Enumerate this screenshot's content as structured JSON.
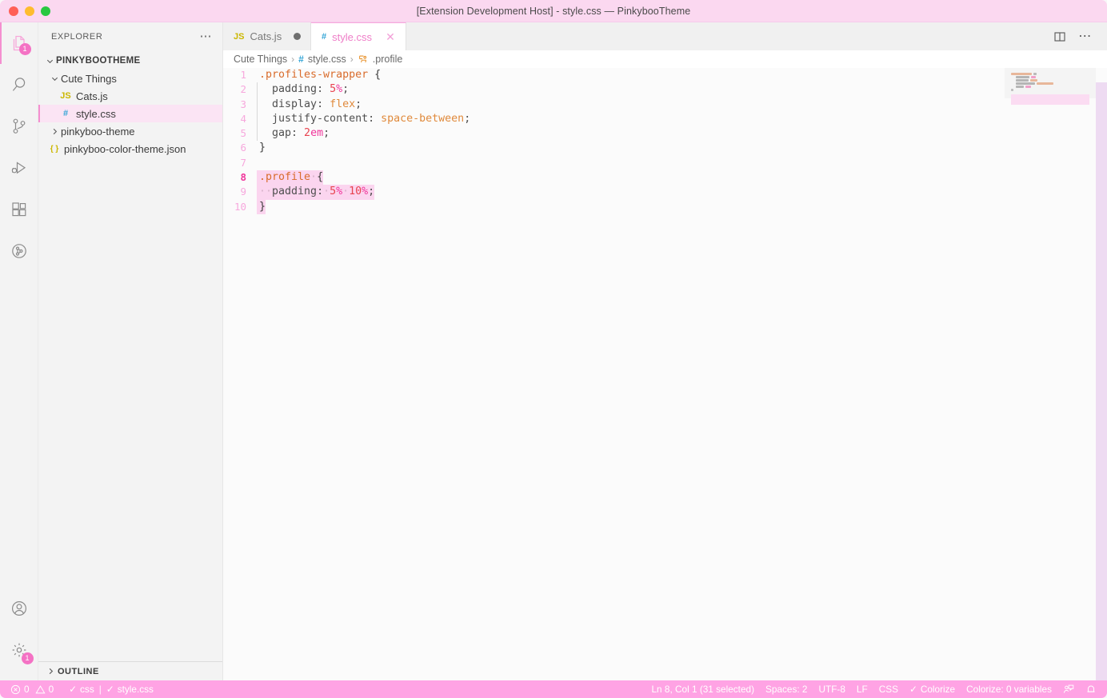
{
  "window": {
    "title": "[Extension Development Host] - style.css — PinkybooTheme",
    "traffic_lights": [
      "close",
      "minimize",
      "zoom"
    ],
    "accent": "#f48fd0",
    "titlebar_bg": "#fbd8f0",
    "statusbar_bg": "#ffa3e4"
  },
  "activity_bar": {
    "items": [
      {
        "name": "explorer",
        "icon": "files-icon",
        "active": true,
        "badge": "1"
      },
      {
        "name": "search",
        "icon": "search-icon",
        "active": false,
        "badge": ""
      },
      {
        "name": "source-control",
        "icon": "source-control-icon",
        "active": false,
        "badge": ""
      },
      {
        "name": "run-and-debug",
        "icon": "run-debug-icon",
        "active": false,
        "badge": ""
      },
      {
        "name": "extensions",
        "icon": "extensions-icon",
        "active": false,
        "badge": ""
      },
      {
        "name": "testing",
        "icon": "beaker-icon",
        "active": false,
        "badge": ""
      }
    ],
    "bottom_items": [
      {
        "name": "accounts",
        "icon": "account-icon",
        "badge": ""
      },
      {
        "name": "manage",
        "icon": "gear-icon",
        "badge": "1"
      }
    ]
  },
  "sidebar": {
    "header": {
      "title": "EXPLORER",
      "more_actions": "⋯"
    },
    "root": {
      "label": "PINKYBOOTHEME",
      "expanded": true,
      "chevron": "chevron-down-icon"
    },
    "tree": [
      {
        "label": "Cute Things",
        "level": 1,
        "type": "folder",
        "expanded": true,
        "icon": "chevron-down-icon",
        "selected": false
      },
      {
        "label": "Cats.js",
        "level": 2,
        "type": "file",
        "icon": "js-icon",
        "icon_text": "JS",
        "icon_color": "#cbb700",
        "selected": false
      },
      {
        "label": "style.css",
        "level": 2,
        "type": "file",
        "icon": "css-icon",
        "icon_text": "#",
        "icon_color": "#34a5d6",
        "selected": true
      },
      {
        "label": "pinkyboo-theme",
        "level": 1,
        "type": "folder",
        "expanded": false,
        "icon": "chevron-right-icon",
        "selected": false
      },
      {
        "label": "pinkyboo-color-theme.json",
        "level": 1,
        "type": "file",
        "icon": "json-icon",
        "icon_text": "{ }",
        "icon_color": "#cbb700",
        "selected": false
      }
    ],
    "outline": {
      "label": "OUTLINE",
      "expanded": false,
      "chevron": "chevron-right-icon"
    }
  },
  "tabs": {
    "items": [
      {
        "label": "Cats.js",
        "icon_text": "JS",
        "icon_color": "#cbb700",
        "active": false,
        "dirty": true,
        "closable": false
      },
      {
        "label": "style.css",
        "icon_text": "#",
        "icon_color": "#34a5d6",
        "active": true,
        "dirty": false,
        "closable": true,
        "close_glyph": "✕"
      }
    ],
    "actions": [
      {
        "name": "split-editor-button",
        "icon": "split-editor-icon"
      },
      {
        "name": "more-actions-button",
        "icon": "kebab-icon",
        "glyph": "⋯"
      }
    ]
  },
  "breadcrumbs": {
    "separator": "›",
    "items": [
      {
        "label": "Cute Things",
        "icon": ""
      },
      {
        "label": "style.css",
        "icon": "css-icon",
        "icon_text": "#"
      },
      {
        "label": ".profile",
        "icon": "css-selector-icon"
      }
    ]
  },
  "editor": {
    "language": "css",
    "file": "style.css",
    "lines": [
      {
        "number": 1,
        "tokens": [
          {
            "text": ".profiles-wrapper",
            "kind": "selector"
          },
          {
            "text": " {",
            "kind": "brace"
          }
        ]
      },
      {
        "number": 2,
        "guide": true,
        "tokens": [
          {
            "text": "  padding",
            "kind": "prop"
          },
          {
            "text": ": ",
            "kind": "punc"
          },
          {
            "text": "5",
            "kind": "number"
          },
          {
            "text": "%",
            "kind": "unit"
          },
          {
            "text": ";",
            "kind": "punc"
          }
        ]
      },
      {
        "number": 3,
        "guide": true,
        "tokens": [
          {
            "text": "  display",
            "kind": "prop"
          },
          {
            "text": ": ",
            "kind": "punc"
          },
          {
            "text": "flex",
            "kind": "value"
          },
          {
            "text": ";",
            "kind": "punc"
          }
        ]
      },
      {
        "number": 4,
        "guide": true,
        "tokens": [
          {
            "text": "  justify-content",
            "kind": "prop"
          },
          {
            "text": ": ",
            "kind": "punc"
          },
          {
            "text": "space-between",
            "kind": "value"
          },
          {
            "text": ";",
            "kind": "punc"
          }
        ]
      },
      {
        "number": 5,
        "guide": true,
        "tokens": [
          {
            "text": "  gap",
            "kind": "prop"
          },
          {
            "text": ": ",
            "kind": "punc"
          },
          {
            "text": "2",
            "kind": "number"
          },
          {
            "text": "em",
            "kind": "unit"
          },
          {
            "text": ";",
            "kind": "punc"
          }
        ]
      },
      {
        "number": 6,
        "tokens": [
          {
            "text": "}",
            "kind": "brace"
          }
        ]
      },
      {
        "number": 7,
        "tokens": []
      },
      {
        "number": 8,
        "current": true,
        "selected": true,
        "tokens": [
          {
            "text": ".profile",
            "kind": "selector",
            "sel": true
          },
          {
            "text": "·",
            "kind": "whitespace",
            "sel": true
          },
          {
            "text": "{",
            "kind": "brace",
            "sel": true
          }
        ]
      },
      {
        "number": 9,
        "selected": true,
        "tokens": [
          {
            "text": "··",
            "kind": "whitespace",
            "sel": true
          },
          {
            "text": "padding",
            "kind": "prop",
            "sel": true
          },
          {
            "text": ":",
            "kind": "punc",
            "sel": true
          },
          {
            "text": "·",
            "kind": "whitespace",
            "sel": true
          },
          {
            "text": "5",
            "kind": "number",
            "sel": true
          },
          {
            "text": "%",
            "kind": "unit",
            "sel": true
          },
          {
            "text": "·",
            "kind": "whitespace",
            "sel": true
          },
          {
            "text": "10",
            "kind": "number",
            "sel": true
          },
          {
            "text": "%",
            "kind": "unit",
            "sel": true
          },
          {
            "text": ";",
            "kind": "punc",
            "sel": true
          }
        ]
      },
      {
        "number": 10,
        "selected": true,
        "tokens": [
          {
            "text": "}",
            "kind": "brace",
            "sel": true
          }
        ]
      }
    ],
    "token_colors": {
      "selector": "#d96c2c",
      "brace": "#3b3b3b",
      "prop": "#4f4f4f",
      "punc": "#4f4f4f",
      "number": "#e8434f",
      "unit": "#f0359b",
      "value": "#e08a3c",
      "line_number": "#f7a8dd",
      "line_number_active": "#f0359b",
      "selection_bg": "#fbd5ef"
    }
  },
  "status_bar": {
    "left": [
      {
        "name": "problems",
        "icon": "error-icon",
        "errors": "0",
        "warn_icon": "warning-icon",
        "warnings": "0"
      },
      {
        "name": "colorize-css",
        "check": "✓",
        "label": "css"
      },
      {
        "name": "separator",
        "label": "|"
      },
      {
        "name": "colorize-file",
        "check": "✓",
        "label": "style.css"
      }
    ],
    "right": [
      {
        "name": "editor-selection",
        "label": "Ln 8, Col 1 (31 selected)"
      },
      {
        "name": "indentation",
        "label": "Spaces: 2"
      },
      {
        "name": "encoding",
        "label": "UTF-8"
      },
      {
        "name": "eol",
        "label": "LF"
      },
      {
        "name": "language-mode",
        "label": "CSS"
      },
      {
        "name": "colorize-status",
        "label": "Colorize",
        "check": "✓"
      },
      {
        "name": "colorize-variables",
        "label": "Colorize: 0 variables"
      },
      {
        "name": "feedback",
        "icon": "feedback-icon"
      },
      {
        "name": "notifications",
        "icon": "bell-icon"
      }
    ]
  }
}
